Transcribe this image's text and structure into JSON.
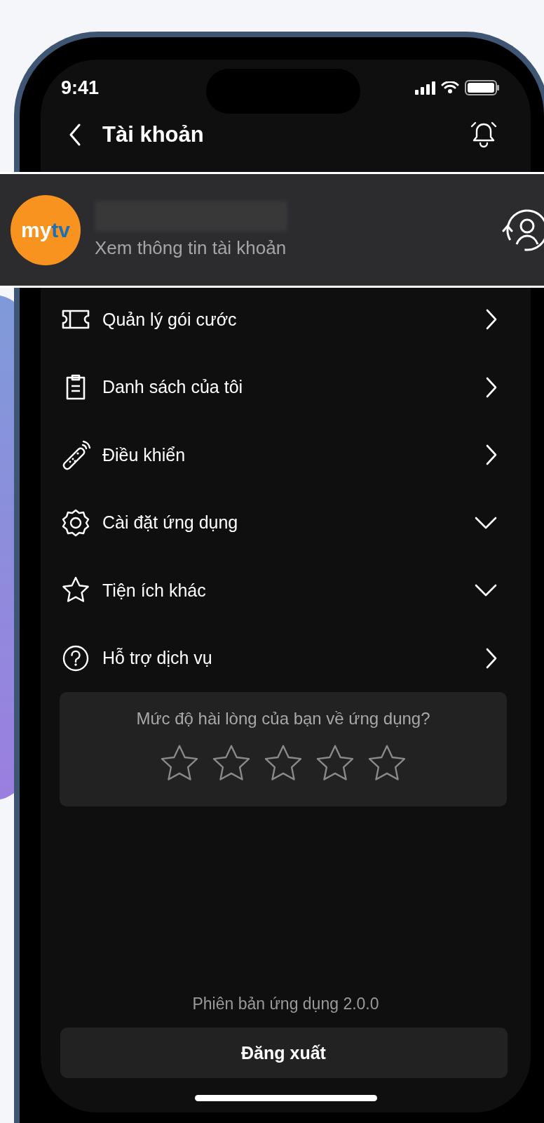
{
  "status_bar": {
    "time": "9:41"
  },
  "header": {
    "title": "Tài khoản"
  },
  "profile": {
    "logo_left": "my",
    "logo_right": "tv",
    "subtitle": "Xem thông tin tài khoản"
  },
  "menu": [
    {
      "label": "Quản lý gói cước",
      "kind": "link"
    },
    {
      "label": "Danh sách của tôi",
      "kind": "link"
    },
    {
      "label": "Điều khiển",
      "kind": "link"
    },
    {
      "label": "Cài đặt ứng dụng",
      "kind": "expandable",
      "expanded": false
    },
    {
      "label": "Tiện ích khác",
      "kind": "expandable",
      "expanded": false
    },
    {
      "label": "Hỗ trợ dịch vụ",
      "kind": "link"
    }
  ],
  "rating": {
    "question": "Mức độ hài lòng của bạn về ứng dụng?",
    "stars": 0
  },
  "version": "Phiên bản ứng dụng 2.0.0",
  "logout_button": "Đăng xuất"
}
